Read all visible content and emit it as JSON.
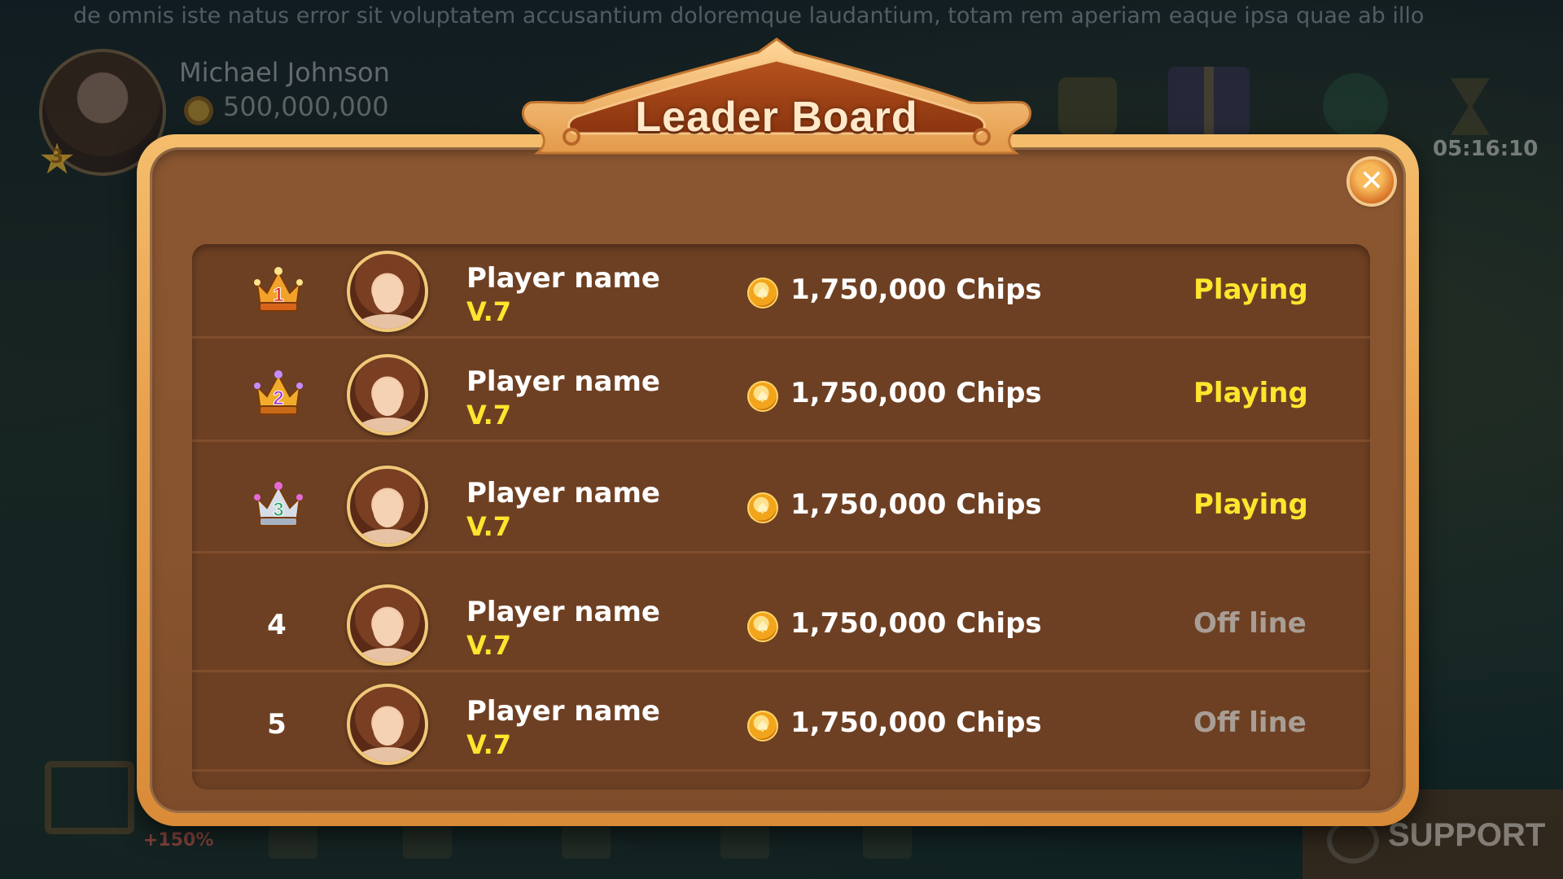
{
  "background": {
    "marquee_text": "de omnis iste natus error sit voluptatem accusantium doloremque laudantium, totam rem aperiam eaque ipsa quae ab illo",
    "user": {
      "name": "Michael Johnson",
      "chips": "500,000,000",
      "level": "3"
    },
    "timer": "05:16:10",
    "bonus_badge": "+150%",
    "support_label": "SUPPORT"
  },
  "dialog": {
    "title": "Leader Board",
    "close_icon": "✕"
  },
  "leaderboard": {
    "rows": [
      {
        "rank": "1",
        "rank_style": "crown-gold",
        "name": "Player name",
        "level": "V.7",
        "chips": "1,750,000 Chips",
        "status": "Playing"
      },
      {
        "rank": "2",
        "rank_style": "crown-purple",
        "name": "Player name",
        "level": "V.7",
        "chips": "1,750,000 Chips",
        "status": "Playing"
      },
      {
        "rank": "3",
        "rank_style": "crown-silver",
        "name": "Player name",
        "level": "V.7",
        "chips": "1,750,000 Chips",
        "status": "Playing"
      },
      {
        "rank": "4",
        "rank_style": "number",
        "name": "Player name",
        "level": "V.7",
        "chips": "1,750,000 Chips",
        "status": "Off line"
      },
      {
        "rank": "5",
        "rank_style": "number",
        "name": "Player name",
        "level": "V.7",
        "chips": "1,750,000 Chips",
        "status": "Off line"
      }
    ]
  },
  "colors": {
    "status_playing": "#ffe52e",
    "status_offline": "#a99e95",
    "level": "#ffe52e",
    "frame": "#e9a14e",
    "panel": "#6e4023"
  },
  "icons": {
    "coin": "spade-coin-icon",
    "crown": "crown-icon",
    "close": "close-icon"
  }
}
